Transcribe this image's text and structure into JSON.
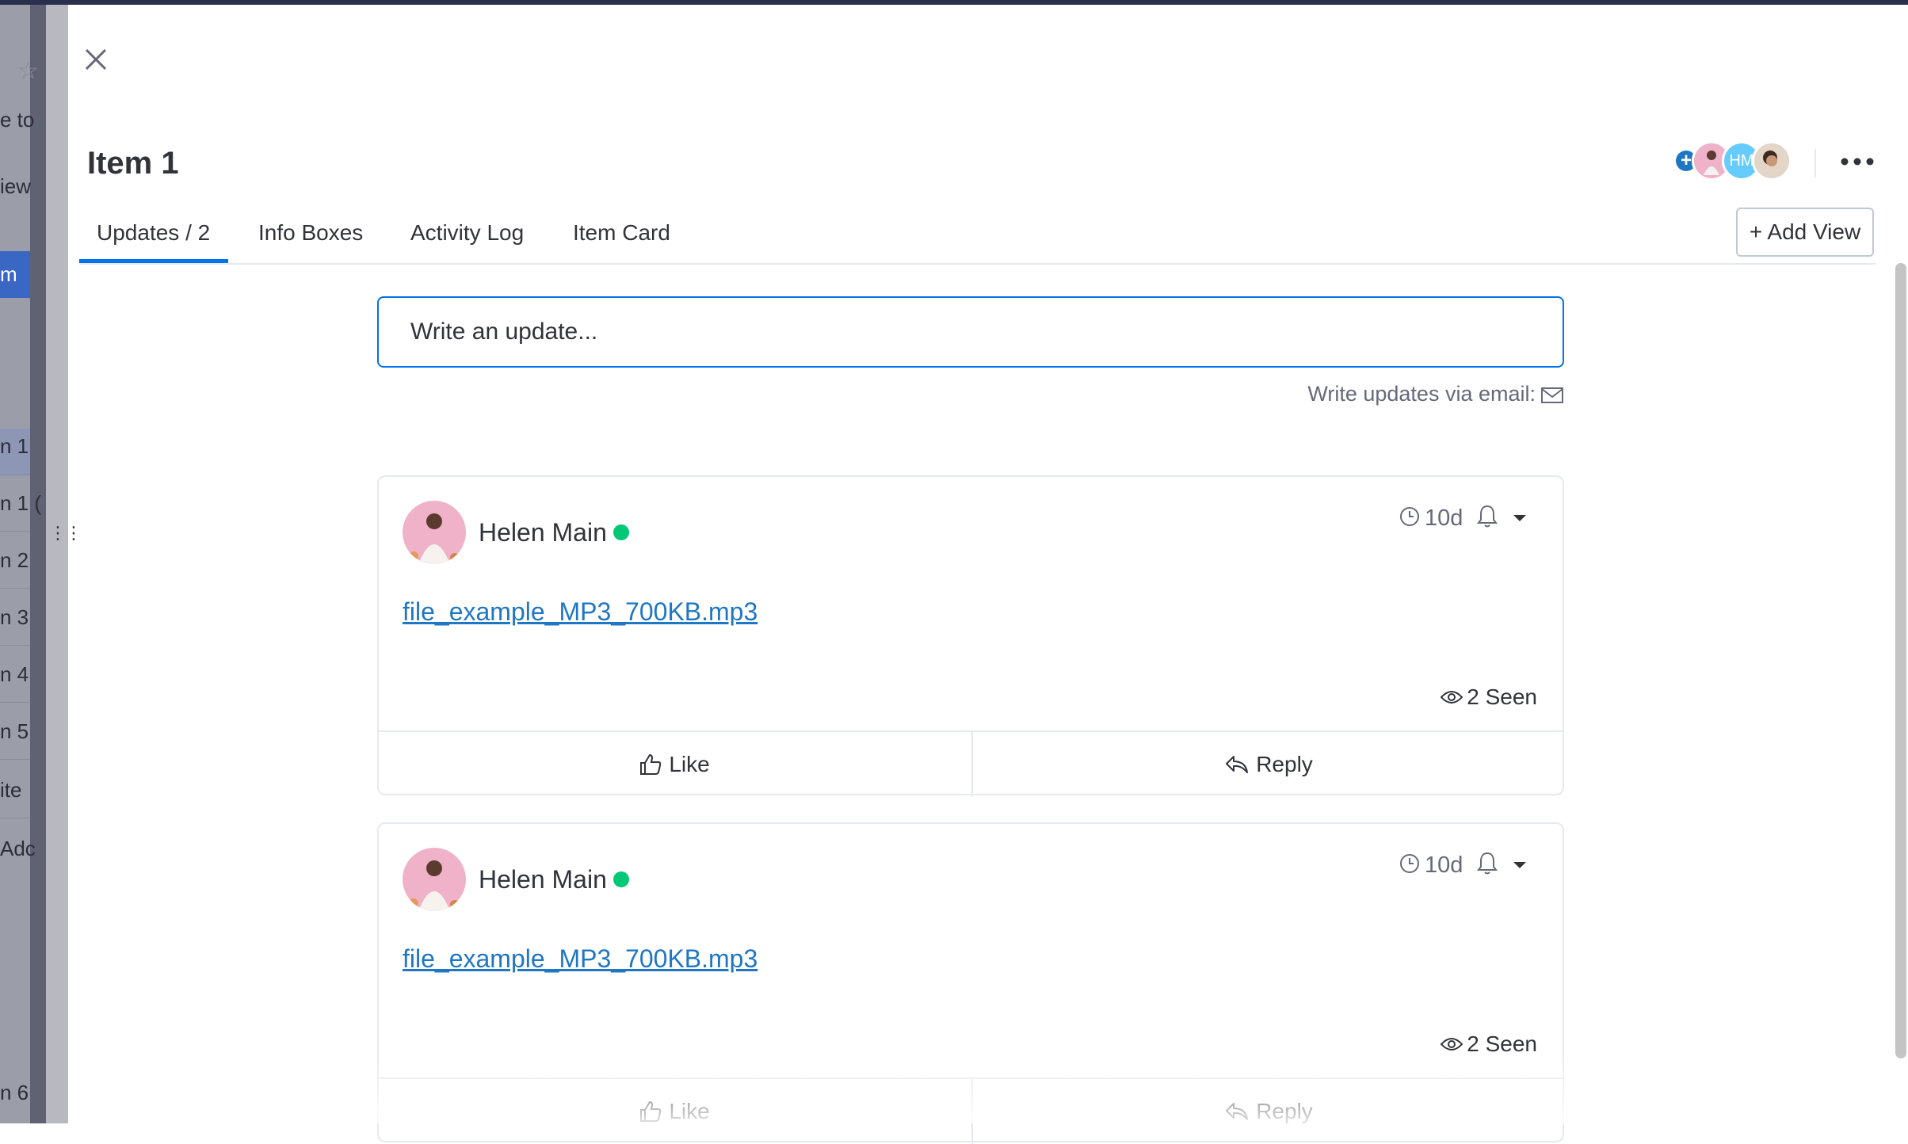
{
  "background_board": {
    "row_fragments": [
      "e to",
      "iew",
      "m",
      "n 1",
      "n 1 (",
      "n 2",
      "n 3",
      "n 4",
      "n 5",
      " ite",
      "Adc",
      "n 6"
    ]
  },
  "item": {
    "title": "Item 1"
  },
  "header": {
    "subscriber_initials": "HM",
    "add_view_label": "+ Add View"
  },
  "tabs": [
    {
      "label": "Updates / 2",
      "active": true
    },
    {
      "label": "Info Boxes",
      "active": false
    },
    {
      "label": "Activity Log",
      "active": false
    },
    {
      "label": "Item Card",
      "active": false
    }
  ],
  "composer": {
    "placeholder": "Write an update...",
    "email_hint": "Write updates via email:"
  },
  "updates": [
    {
      "author": "Helen Main",
      "time": "10d",
      "file": "file_example_MP3_700KB.mp3",
      "seen": "2 Seen",
      "like_label": "Like",
      "reply_label": "Reply"
    },
    {
      "author": "Helen Main",
      "time": "10d",
      "file": "file_example_MP3_700KB.mp3",
      "seen": "2 Seen",
      "like_label": "Like",
      "reply_label": "Reply"
    }
  ],
  "colors": {
    "accent": "#0073ea",
    "online": "#00c875",
    "link": "#1f76c2"
  }
}
